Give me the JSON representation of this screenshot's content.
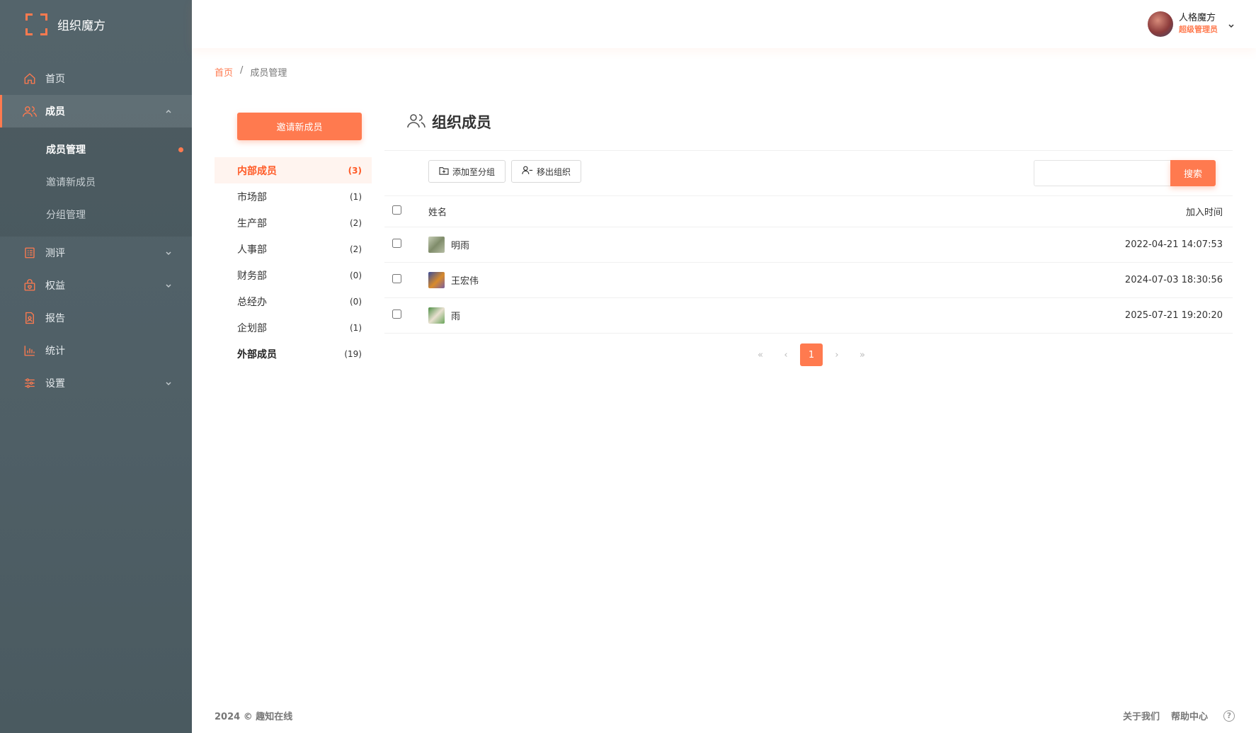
{
  "brand": {
    "name": "组织魔方"
  },
  "nav": {
    "home": "首页",
    "members": "成员",
    "members_sub": [
      "成员管理",
      "邀请新成员",
      "分组管理"
    ],
    "assessment": "测评",
    "benefits": "权益",
    "report": "报告",
    "stats": "统计",
    "settings": "设置"
  },
  "user": {
    "name": "人格魔方",
    "role": "超级管理员"
  },
  "breadcrumb": {
    "home": "首页",
    "separator": "/",
    "current": "成员管理"
  },
  "invite_button": "邀请新成员",
  "groups": [
    {
      "name": "内部成员",
      "count": "(3)"
    },
    {
      "name": "市场部",
      "count": "(1)"
    },
    {
      "name": "生产部",
      "count": "(2)"
    },
    {
      "name": "人事部",
      "count": "(2)"
    },
    {
      "name": "财务部",
      "count": "(0)"
    },
    {
      "name": "总经办",
      "count": "(0)"
    },
    {
      "name": "企划部",
      "count": "(1)"
    },
    {
      "name": "外部成员",
      "count": "(19)"
    }
  ],
  "content": {
    "title": "组织成员",
    "add_to_group": "添加至分组",
    "remove_from_org": "移出组织",
    "search_button": "搜索",
    "search_placeholder": ""
  },
  "table": {
    "columns": {
      "name": "姓名",
      "joined": "加入时间"
    },
    "rows": [
      {
        "name": "明雨",
        "joined": "2022-04-21 14:07:53",
        "avatar_color": "#9aa88a"
      },
      {
        "name": "王宏伟",
        "joined": "2024-07-03 18:30:56",
        "avatar_color": "#d98b2b"
      },
      {
        "name": "雨",
        "joined": "2025-07-21 19:20:20",
        "avatar_color": "#6aa55a"
      }
    ]
  },
  "pagination": {
    "first": "«",
    "prev": "‹",
    "current": "1",
    "next": "›",
    "last": "»"
  },
  "footer": {
    "copyright": "2024 © 趣知在线",
    "about": "关于我们",
    "help": "帮助中心",
    "help_icon": "?"
  },
  "colors": {
    "accent": "#ff7a4f",
    "sidebar": "#52626a"
  }
}
